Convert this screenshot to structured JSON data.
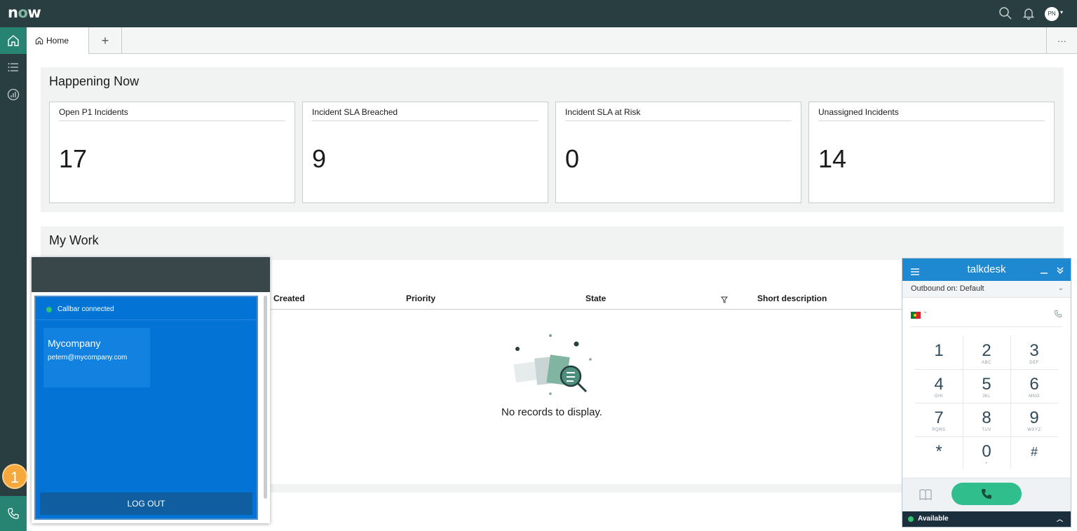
{
  "header": {
    "logo": "now",
    "avatar_initials": "PN"
  },
  "tabs": {
    "home_label": "Home",
    "add_label": "+",
    "more_label": "···"
  },
  "happening_now": {
    "title": "Happening Now",
    "cards": [
      {
        "label": "Open P1 Incidents",
        "value": "17"
      },
      {
        "label": "Incident SLA Breached",
        "value": "9"
      },
      {
        "label": "Incident SLA at Risk",
        "value": "0"
      },
      {
        "label": "Unassigned Incidents",
        "value": "14"
      }
    ]
  },
  "my_work": {
    "title": "My Work",
    "columns": [
      "Created",
      "Priority",
      "State",
      "Short description"
    ],
    "empty_message": "No records to display."
  },
  "sidebar": {
    "badge": "1"
  },
  "callbar": {
    "status": "Callbar connected",
    "company": "Mycompany",
    "email": "petern@mycompany.com",
    "logout_label": "LOG OUT",
    "status_color": "#2fc270"
  },
  "talkdesk": {
    "title": "talkdesk",
    "outbound": "Outbound on: Default",
    "keys": [
      {
        "num": "1",
        "letters": ""
      },
      {
        "num": "2",
        "letters": "ABC"
      },
      {
        "num": "3",
        "letters": "DEF"
      },
      {
        "num": "4",
        "letters": "GHI"
      },
      {
        "num": "5",
        "letters": "JKL"
      },
      {
        "num": "6",
        "letters": "MNO"
      },
      {
        "num": "7",
        "letters": "PQRS"
      },
      {
        "num": "8",
        "letters": "TUV"
      },
      {
        "num": "9",
        "letters": "WXYZ"
      },
      {
        "num": "*",
        "letters": ""
      },
      {
        "num": "0",
        "letters": "+"
      },
      {
        "num": "#",
        "letters": ""
      }
    ],
    "status": "Available",
    "accent": "#1e88d1",
    "call_color": "#2fbe8c"
  }
}
